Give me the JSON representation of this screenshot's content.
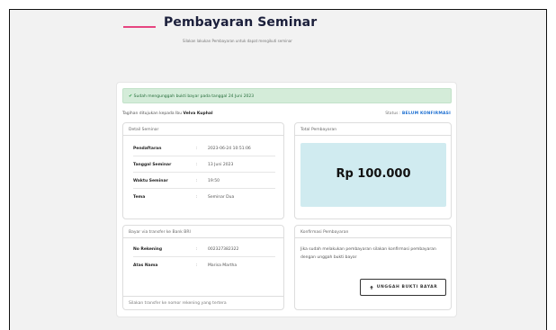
{
  "header": {
    "title": "Pembayaran Seminar",
    "subtitle": "Silakan lakukan Pembayaran untuk dapat mengikuti seminar"
  },
  "alert": {
    "icon": "check-icon",
    "text": "Sudah mengunggah bukti bayar pada tanggal 24 Juni 2023",
    "color": "#d4ecd9"
  },
  "recipient": {
    "prefix": "Tagihan ditujukan kepada Ibu",
    "name": "Velva Kuphal"
  },
  "status": {
    "label": "Status :",
    "value": "BELUM KONFIRMASI",
    "color": "#1d6fd1"
  },
  "detail": {
    "title": "Detail Seminar",
    "rows": [
      {
        "label": "Pendaftaran",
        "value": "2023-06-24 10:51:06"
      },
      {
        "label": "Tanggal Seminar",
        "value": "13 Juni 2023"
      },
      {
        "label": "Waktu Seminar",
        "value": "19:50"
      },
      {
        "label": "Tema",
        "value": "Seminar Dua"
      }
    ]
  },
  "total": {
    "title": "Total Pembayaran",
    "amount": "Rp 100.000",
    "color": "#d0ebf0"
  },
  "bank": {
    "title": "Bayar via transfer ke Bank BRI",
    "rows": [
      {
        "label": "No Rekening",
        "value": "002327382322"
      },
      {
        "label": "Atas Nama",
        "value": "Marisa Martha"
      }
    ],
    "footer": "Silakan transfer ke nomor rekening yang tertera"
  },
  "konfirmasi": {
    "title": "Konfirmasi Pembayaran",
    "text": "Jika sudah melakukan pembayaran silakan konfirmasi pembayaran dengan unggah bukti bayar",
    "button_label": "UNGGAH BUKTI BAYAR",
    "button_icon": "upload-icon"
  },
  "colon": ":",
  "accent": "#e64580"
}
